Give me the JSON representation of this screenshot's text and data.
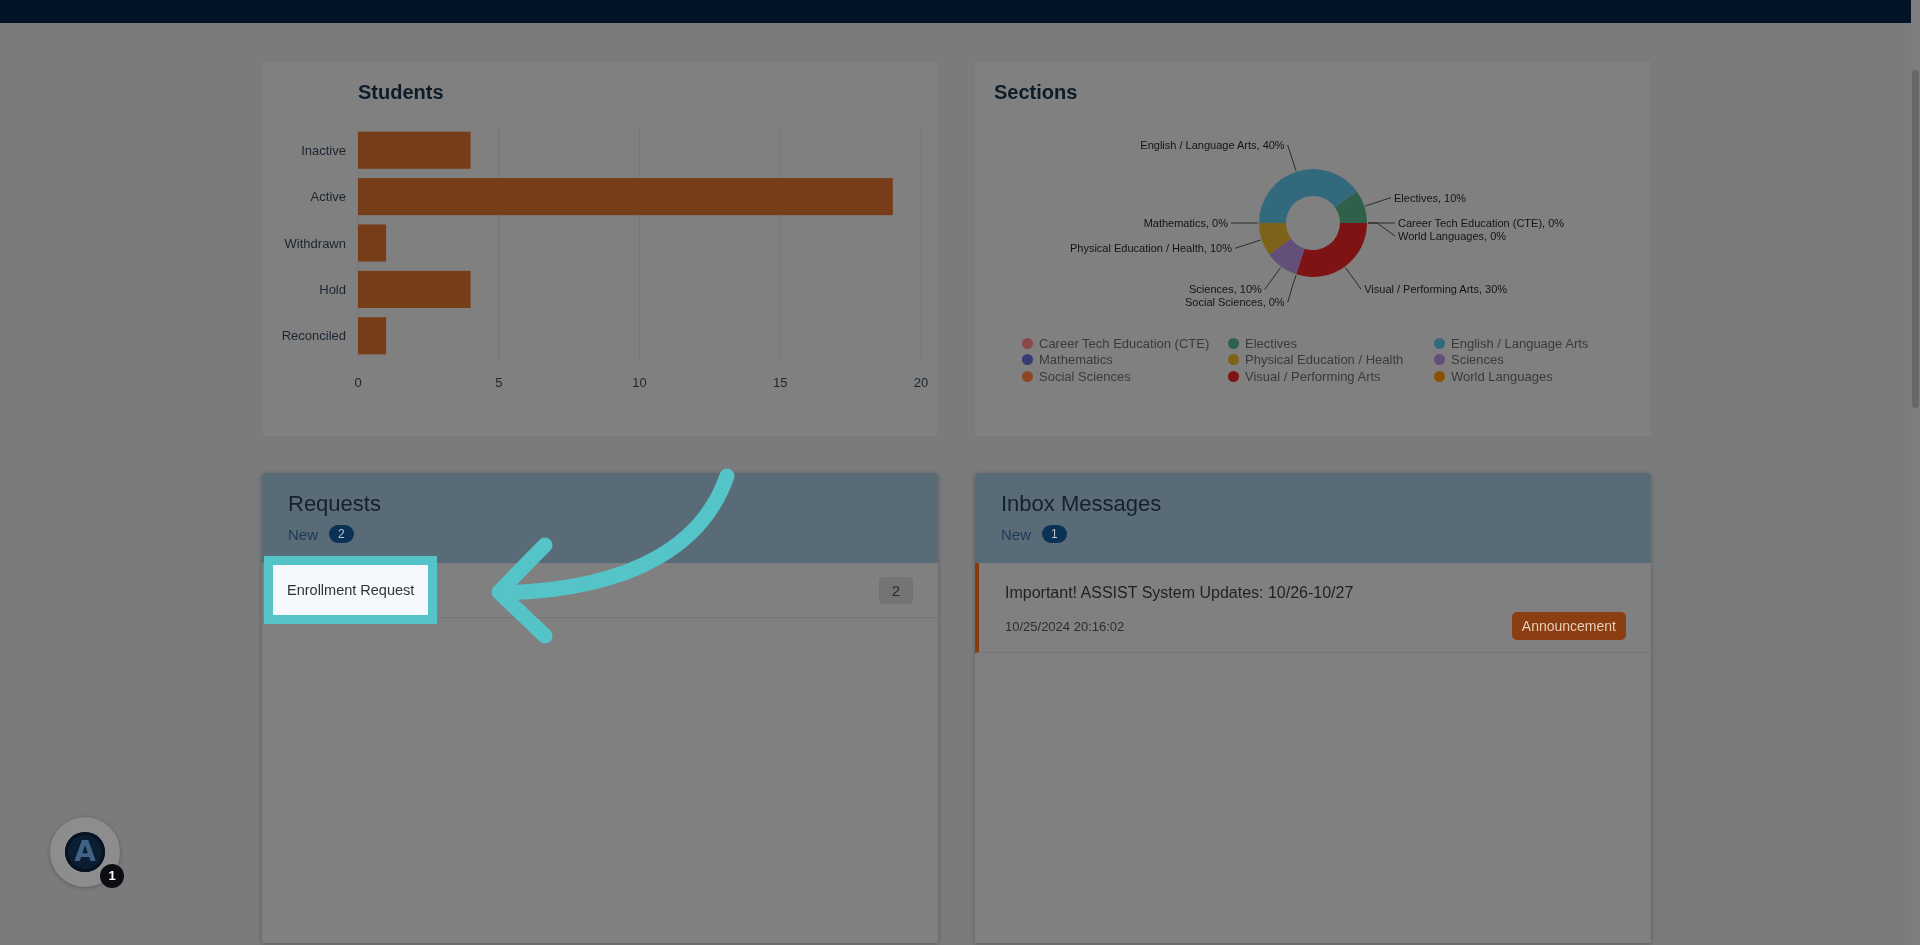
{
  "students": {
    "chart_data": {
      "type": "bar",
      "orientation": "horizontal",
      "title": "Students",
      "categories": [
        "Inactive",
        "Active",
        "Withdrawn",
        "Hold",
        "Reconciled"
      ],
      "values": [
        4,
        19,
        1,
        4,
        1
      ],
      "xlim": [
        0,
        20
      ],
      "xticks": [
        0,
        5,
        10,
        15,
        20
      ],
      "grid": true
    }
  },
  "sections": {
    "chart_data": {
      "type": "donut",
      "title": "Sections",
      "categories": [
        "Career Tech Education (CTE)",
        "Electives",
        "English / Language Arts",
        "Mathematics",
        "Physical Education / Health",
        "Sciences",
        "Social Sciences",
        "Visual / Performing Arts",
        "World Languages"
      ],
      "values": [
        0,
        10,
        40,
        0,
        10,
        10,
        0,
        30,
        0
      ],
      "value_labels": [
        "Career Tech Education (CTE), 0%",
        "Electives, 10%",
        "English / Language Arts, 40%",
        "Mathematics, 0%",
        "Physical Education / Health, 10%",
        "Sciences, 10%",
        "Social Sciences, 0%",
        "Visual / Performing Arts, 30%",
        "World Languages, 0%"
      ],
      "legend": "bottom"
    },
    "slices": [
      {
        "color": "#8a4a4a"
      },
      {
        "color": "#2f6049"
      },
      {
        "color": "#33697d"
      },
      {
        "color": "#383a75"
      },
      {
        "color": "#7d6219"
      },
      {
        "color": "#644f7b"
      },
      {
        "color": "#8a4721"
      },
      {
        "color": "#7f1314"
      },
      {
        "color": "#8a5200"
      }
    ]
  },
  "requests": {
    "title": "Requests",
    "new_label": "New",
    "new_count": "2",
    "items": [
      {
        "label": "Enrollment Request",
        "count": "2",
        "highlighted": true
      }
    ]
  },
  "inbox": {
    "title": "Inbox Messages",
    "new_label": "New",
    "new_count": "1",
    "messages": [
      {
        "subject": "Important! ASSIST System Updates: 10/26-10/27",
        "date": "10/25/2024 20:16:02",
        "tag": "Announcement",
        "unread": true
      }
    ]
  },
  "assistant_button": {
    "logo_letter": "A",
    "badge": "1"
  }
}
